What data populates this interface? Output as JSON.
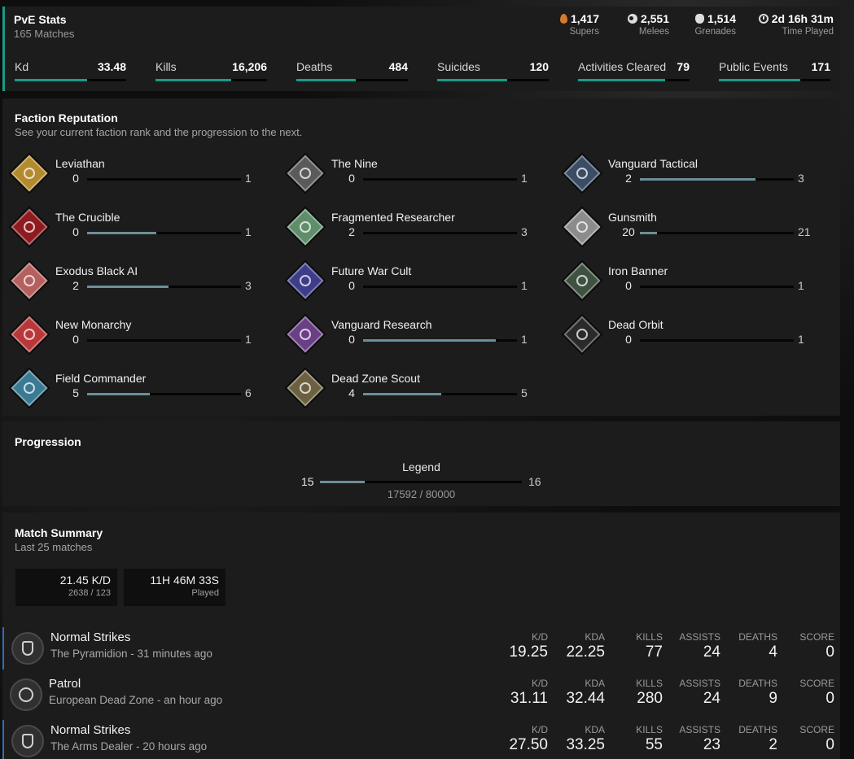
{
  "pve_stats": {
    "title": "PvE Stats",
    "matches": "165 Matches",
    "top": [
      {
        "icon": "flame-icon",
        "value": "1,417",
        "label": "Supers"
      },
      {
        "icon": "melee-icon",
        "value": "2,551",
        "label": "Melees"
      },
      {
        "icon": "grenade-icon",
        "value": "1,514",
        "label": "Grenades"
      },
      {
        "icon": "clock-icon",
        "value": "2d 16h 31m",
        "label": "Time Played"
      }
    ],
    "metrics": [
      {
        "label": "Kd",
        "value": "33.48",
        "fill": 0.65
      },
      {
        "label": "Kills",
        "value": "16,206",
        "fill": 0.68
      },
      {
        "label": "Deaths",
        "value": "484",
        "fill": 0.53
      },
      {
        "label": "Suicides",
        "value": "120",
        "fill": 0.63
      },
      {
        "label": "Activities Cleared",
        "value": "79",
        "fill": 0.78
      },
      {
        "label": "Public Events",
        "value": "171",
        "fill": 0.73
      }
    ]
  },
  "faction_reputation": {
    "title": "Faction Reputation",
    "subtitle": "See your current faction rank and the progression to the next.",
    "factions": [
      {
        "name": "Leviathan",
        "current": "0",
        "next": "1",
        "progress": 0.0,
        "color": "#b38a2e"
      },
      {
        "name": "The Nine",
        "current": "0",
        "next": "1",
        "progress": 0.0,
        "color": "#5a5a5a"
      },
      {
        "name": "Vanguard Tactical",
        "current": "2",
        "next": "3",
        "progress": 0.75,
        "color": "#3a4d64"
      },
      {
        "name": "The Crucible",
        "current": "0",
        "next": "1",
        "progress": 0.45,
        "color": "#8e1b20"
      },
      {
        "name": "Fragmented Researcher",
        "current": "2",
        "next": "3",
        "progress": 0.0,
        "color": "#5f8e6a"
      },
      {
        "name": "Gunsmith",
        "current": "20",
        "next": "21",
        "progress": 0.11,
        "color": "#8c8c8c"
      },
      {
        "name": "Exodus Black AI",
        "current": "2",
        "next": "3",
        "progress": 0.53,
        "color": "#b3605e"
      },
      {
        "name": "Future War Cult",
        "current": "0",
        "next": "1",
        "progress": 0.0,
        "color": "#3d3d8a"
      },
      {
        "name": "Iron Banner",
        "current": "0",
        "next": "1",
        "progress": 0.0,
        "color": "#3f5240"
      },
      {
        "name": "New Monarchy",
        "current": "0",
        "next": "1",
        "progress": 0.0,
        "color": "#b8383a"
      },
      {
        "name": "Vanguard Research",
        "current": "0",
        "next": "1",
        "progress": 0.86,
        "color": "#6a3f85"
      },
      {
        "name": "Dead Orbit",
        "current": "0",
        "next": "1",
        "progress": 0.0,
        "color": "#2a2a2a"
      },
      {
        "name": "Field Commander",
        "current": "5",
        "next": "6",
        "progress": 0.41,
        "color": "#3a7a92"
      },
      {
        "name": "Dead Zone Scout",
        "current": "4",
        "next": "5",
        "progress": 0.51,
        "color": "#6b6140"
      }
    ]
  },
  "progression": {
    "title": "Progression",
    "label": "Legend",
    "current": "15",
    "next": "16",
    "progress": 0.22,
    "xp": "17592 / 80000"
  },
  "match_summary": {
    "title": "Match Summary",
    "subtitle": "Last 25 matches",
    "cards": [
      {
        "big": "21.45 K/D",
        "small": "2638 / 123"
      },
      {
        "big": "11H 46M 33S",
        "small": "Played"
      }
    ],
    "headers": [
      "K/D",
      "KDA",
      "KILLS",
      "ASSISTS",
      "DEATHS",
      "SCORE"
    ],
    "matches": [
      {
        "mode": "Normal Strikes",
        "detail": "The Pyramidion - 31 minutes ago",
        "icon": "strike-icon",
        "stats": [
          "19.25",
          "22.25",
          "77",
          "24",
          "4",
          "0"
        ]
      },
      {
        "mode": "Patrol",
        "detail": "European Dead Zone - an hour ago",
        "icon": "patrol-icon",
        "stats": [
          "31.11",
          "32.44",
          "280",
          "24",
          "9",
          "0"
        ]
      },
      {
        "mode": "Normal Strikes",
        "detail": "The Arms Dealer - 20 hours ago",
        "icon": "strike-icon",
        "stats": [
          "27.50",
          "33.25",
          "55",
          "23",
          "2",
          "0"
        ]
      }
    ]
  }
}
